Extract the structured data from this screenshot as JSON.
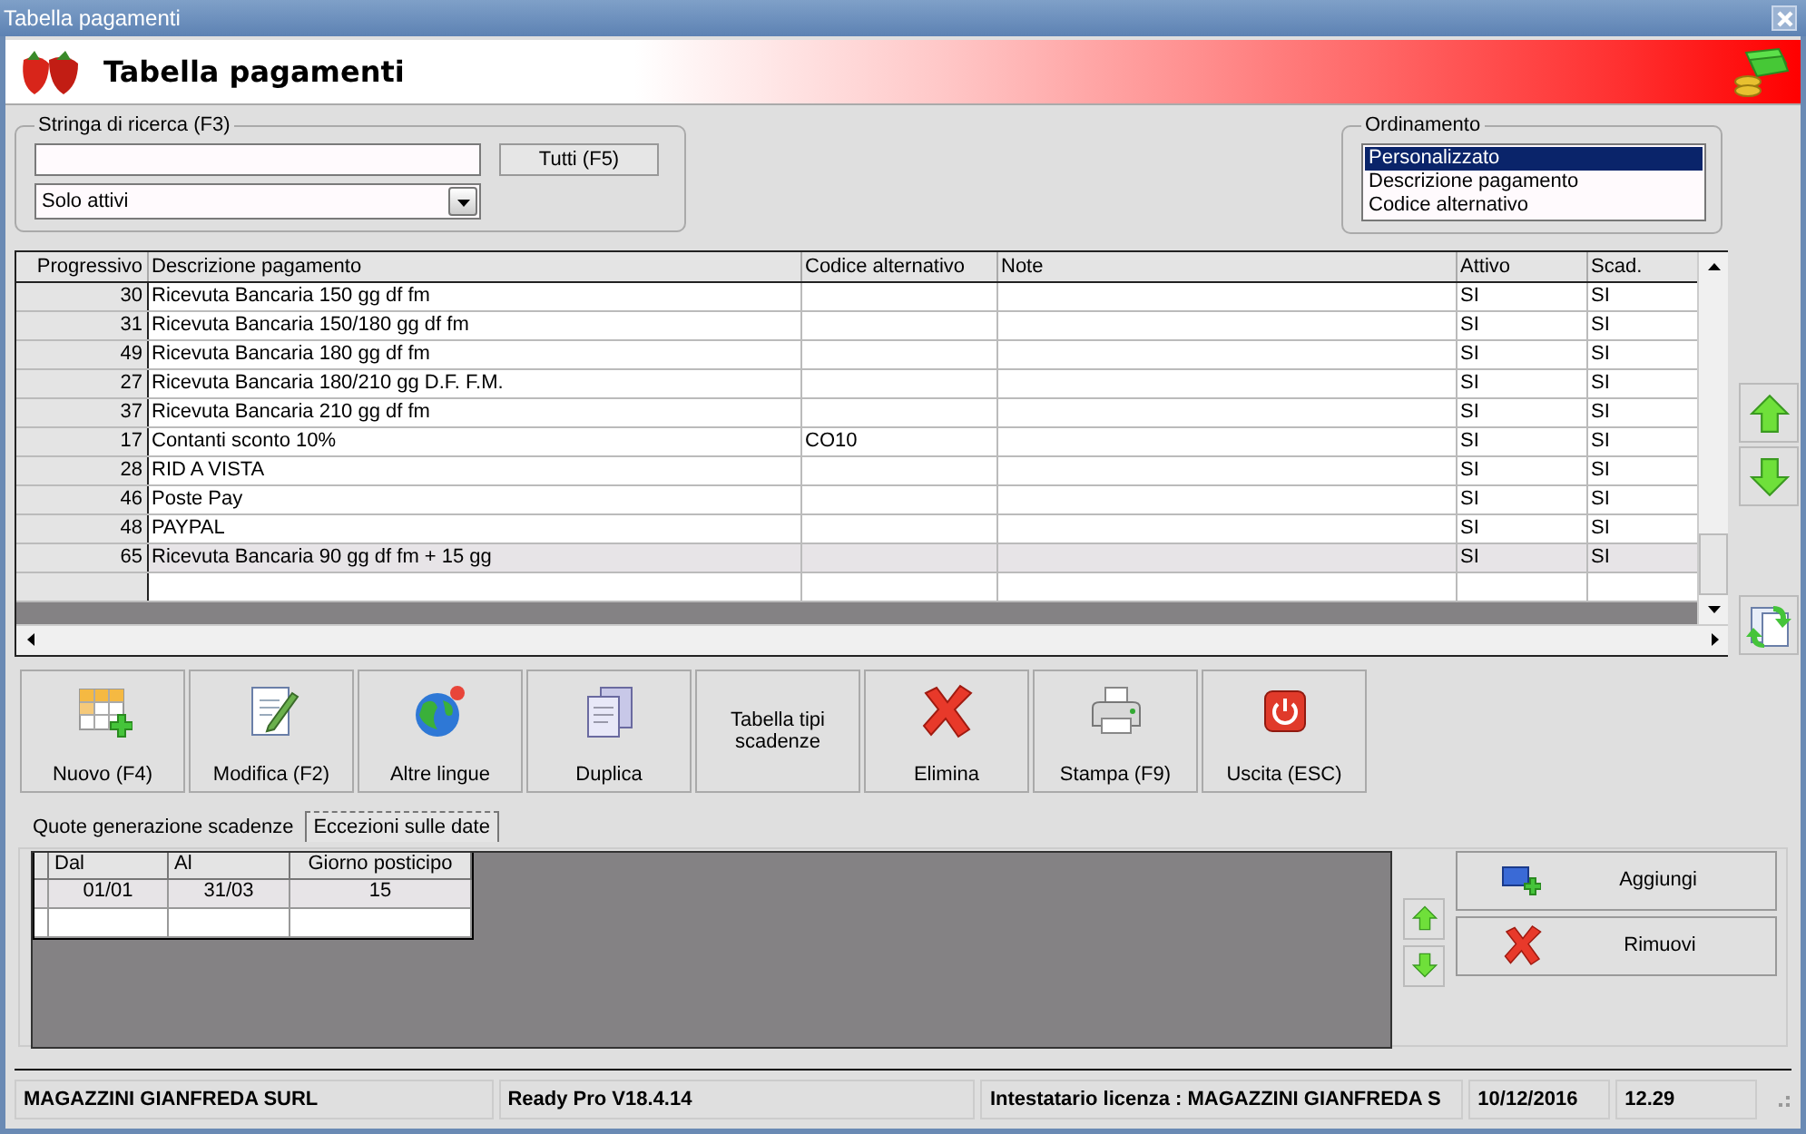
{
  "window": {
    "title": "Tabella pagamenti"
  },
  "header": {
    "title": "Tabella pagamenti"
  },
  "search": {
    "label": "Stringa di ricerca (F3)",
    "all_button": "Tutti (F5)",
    "filter": "Solo attivi"
  },
  "ordering": {
    "label": "Ordinamento",
    "options": [
      {
        "label": "Personalizzato",
        "selected": true
      },
      {
        "label": "Descrizione pagamento",
        "selected": false
      },
      {
        "label": "Codice alternativo",
        "selected": false
      }
    ]
  },
  "table": {
    "columns": [
      "Progressivo",
      "Descrizione pagamento",
      "Codice alternativo",
      "Note",
      "Attivo",
      "Scad."
    ],
    "rows": [
      {
        "cells": [
          "30",
          "Ricevuta Bancaria 150 gg df fm",
          "",
          "",
          "SI",
          "SI"
        ],
        "selected": false
      },
      {
        "cells": [
          "31",
          "Ricevuta Bancaria 150/180 gg df fm",
          "",
          "",
          "SI",
          "SI"
        ],
        "selected": false
      },
      {
        "cells": [
          "49",
          "Ricevuta Bancaria 180 gg df fm",
          "",
          "",
          "SI",
          "SI"
        ],
        "selected": false
      },
      {
        "cells": [
          "27",
          "Ricevuta Bancaria 180/210 gg D.F. F.M.",
          "",
          "",
          "SI",
          "SI"
        ],
        "selected": false
      },
      {
        "cells": [
          "37",
          "Ricevuta Bancaria 210 gg df fm",
          "",
          "",
          "SI",
          "SI"
        ],
        "selected": false
      },
      {
        "cells": [
          "17",
          "Contanti sconto 10%",
          "CO10",
          "",
          "SI",
          "SI"
        ],
        "selected": false
      },
      {
        "cells": [
          "28",
          "RID A VISTA",
          "",
          "",
          "SI",
          "SI"
        ],
        "selected": false
      },
      {
        "cells": [
          "46",
          "Poste Pay",
          "",
          "",
          "SI",
          "SI"
        ],
        "selected": false
      },
      {
        "cells": [
          "48",
          "PAYPAL",
          "",
          "",
          "SI",
          "SI"
        ],
        "selected": false
      },
      {
        "cells": [
          "65",
          "Ricevuta Bancaria 90 gg df fm + 15 gg",
          "",
          "",
          "SI",
          "SI"
        ],
        "selected": true
      }
    ]
  },
  "toolbar": [
    {
      "label": "Nuovo (F4)",
      "kind": "new"
    },
    {
      "label": "Modifica (F2)",
      "kind": "edit"
    },
    {
      "label": "Altre lingue",
      "kind": "globe"
    },
    {
      "label": "Duplica",
      "kind": "copy"
    },
    {
      "label": "Tabella tipi scadenze",
      "kind": "text"
    },
    {
      "label": "Elimina",
      "kind": "delete"
    },
    {
      "label": "Stampa (F9)",
      "kind": "print"
    },
    {
      "label": "Uscita (ESC)",
      "kind": "exit"
    }
  ],
  "tabs": [
    {
      "label": "Quote generazione scadenze",
      "selected": false
    },
    {
      "label": "Eccezioni sulle date",
      "selected": true
    }
  ],
  "exceptions": {
    "columns": [
      "Dal",
      "Al",
      "Giorno posticipo"
    ],
    "rows": [
      {
        "cells": [
          "01/01",
          "31/03",
          "15"
        ],
        "selected": true
      }
    ]
  },
  "side_buttons": [
    {
      "label": "Aggiungi",
      "kind": "add"
    },
    {
      "label": "Rimuovi",
      "kind": "delete"
    }
  ],
  "status_bar": [
    "MAGAZZINI GIANFREDA SURL",
    "Ready Pro V18.4.14",
    "Intestatario licenza : MAGAZZINI GIANFREDA S",
    "10/12/2016",
    "12.29"
  ]
}
